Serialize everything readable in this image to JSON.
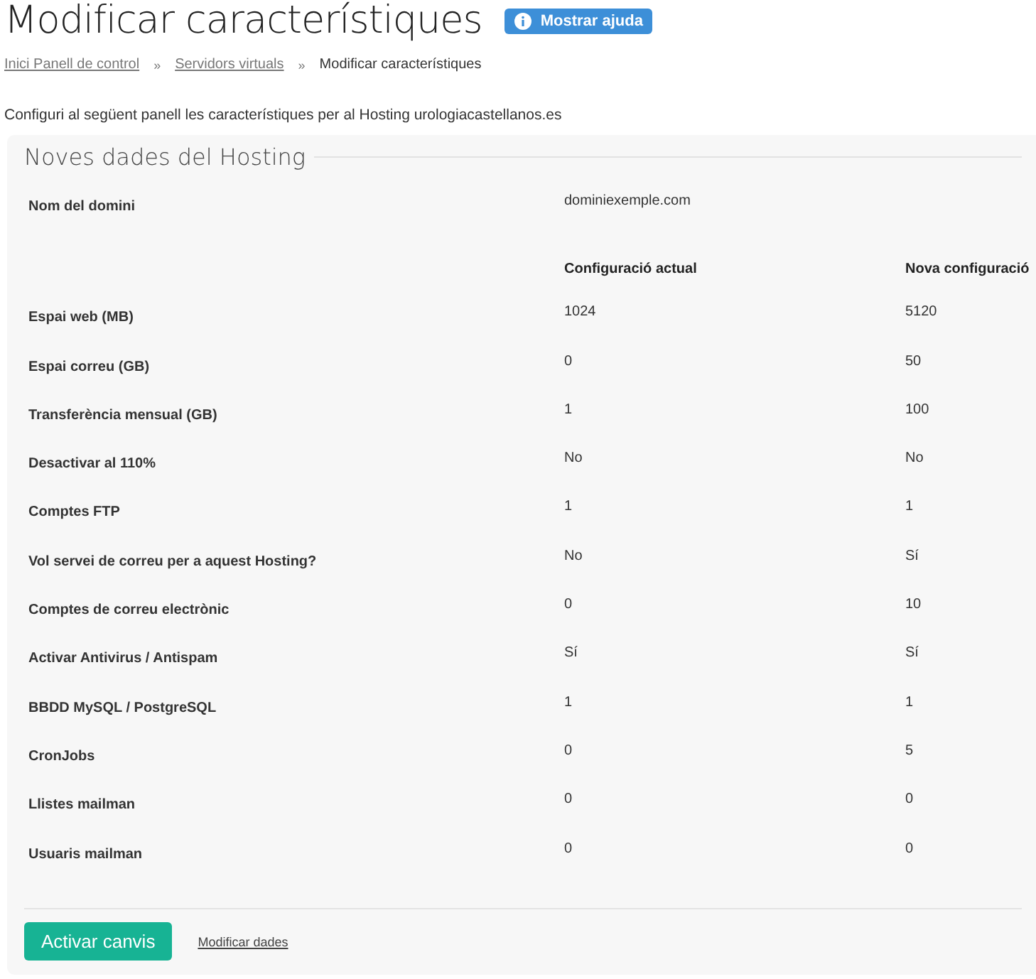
{
  "title": "Modificar característiques",
  "help_button": "Mostrar ajuda",
  "breadcrumb": [
    {
      "label": "Inici Panell de control",
      "link": true
    },
    {
      "label": "Servidors virtuals",
      "link": true
    },
    {
      "label": "Modificar característiques",
      "link": false
    }
  ],
  "breadcrumb_separator": "»",
  "intro": "Configuri al següent panell les característiques per al Hosting urologiacastellanos.es",
  "panel": {
    "legend": "Noves dades del Hosting",
    "domain": {
      "label": "Nom del domini",
      "value": "dominiexemple.com"
    },
    "columns": [
      "Configuració actual",
      "Nova configuració"
    ],
    "rows": [
      {
        "label": "Espai web (MB)",
        "current": "1024",
        "new": "5120"
      },
      {
        "label": "Espai correu (GB)",
        "current": "0",
        "new": "50"
      },
      {
        "label": "Transferència mensual (GB)",
        "current": "1",
        "new": "100"
      },
      {
        "label": "Desactivar al 110%",
        "current": "No",
        "new": "No"
      },
      {
        "label": "Comptes FTP",
        "current": "1",
        "new": "1"
      },
      {
        "label": "Vol servei de correu per a aquest Hosting?",
        "current": "No",
        "new": "Sí"
      },
      {
        "label": "Comptes de correu electrònic",
        "current": "0",
        "new": "10"
      },
      {
        "label": "Activar Antivirus / Antispam",
        "current": "Sí",
        "new": "Sí"
      },
      {
        "label": "BBDD MySQL / PostgreSQL",
        "current": "1",
        "new": "1"
      },
      {
        "label": "CronJobs",
        "current": "0",
        "new": "5"
      },
      {
        "label": "Llistes mailman",
        "current": "0",
        "new": "0"
      },
      {
        "label": "Usuaris mailman",
        "current": "0",
        "new": "0"
      }
    ],
    "submit": "Activar canvis",
    "modify_link": "Modificar dades"
  }
}
